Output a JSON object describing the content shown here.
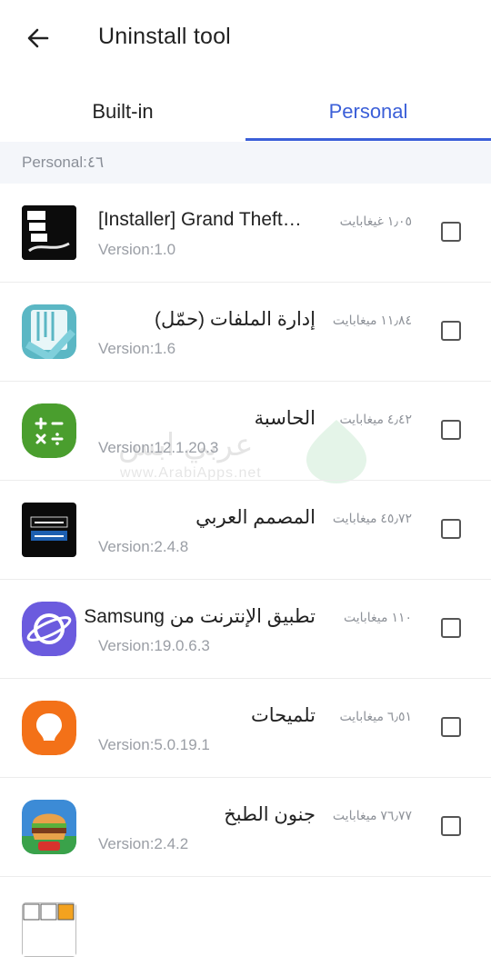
{
  "appbar": {
    "title": "Uninstall tool"
  },
  "tabs": [
    {
      "label": "Built-in",
      "selected": false
    },
    {
      "label": "Personal",
      "selected": true
    }
  ],
  "section": {
    "header": "Personal:٤٦"
  },
  "colors": {
    "accent": "#3b5fd8",
    "text": "#222222",
    "muted": "#9a9ea5",
    "header_bg": "#f4f6fa"
  },
  "apps": [
    {
      "icon": "gta-vice-city-icon",
      "name": "[Installer] Grand Theft…",
      "size": "١٫٠٥ غيغابايت",
      "version": "Version:1.0",
      "checked": false
    },
    {
      "icon": "file-manager-icon",
      "name": "إدارة الملفات (حمّل)",
      "size": "١١٫٨٤ ميغابايت",
      "version": "Version:1.6",
      "checked": false
    },
    {
      "icon": "calculator-icon",
      "name": "الحاسبة",
      "size": "٤٫٤٢ ميغابايت",
      "version": "Version:12.1.20.3",
      "checked": false
    },
    {
      "icon": "arabic-designer-icon",
      "name": "المصمم العربي",
      "size": "٤٥٫٧٢ ميغابايت",
      "version": "Version:2.4.8",
      "checked": false
    },
    {
      "icon": "samsung-internet-icon",
      "name": "تطبيق الإنترنت من Samsung",
      "size": "١١٠ ميغابايت",
      "version": "Version:19.0.6.3",
      "checked": false
    },
    {
      "icon": "tips-bulb-icon",
      "name": "تلميحات",
      "size": "٦٫٥١ ميغابايت",
      "version": "Version:5.0.19.1",
      "checked": false
    },
    {
      "icon": "cooking-fever-icon",
      "name": "جنون الطبخ",
      "size": "٧٦٫٧٧ ميغابايت",
      "version": "Version:2.4.2",
      "checked": false
    }
  ],
  "watermark": {
    "text": "عربي ابس",
    "sub": "www.ArabiApps.net"
  }
}
